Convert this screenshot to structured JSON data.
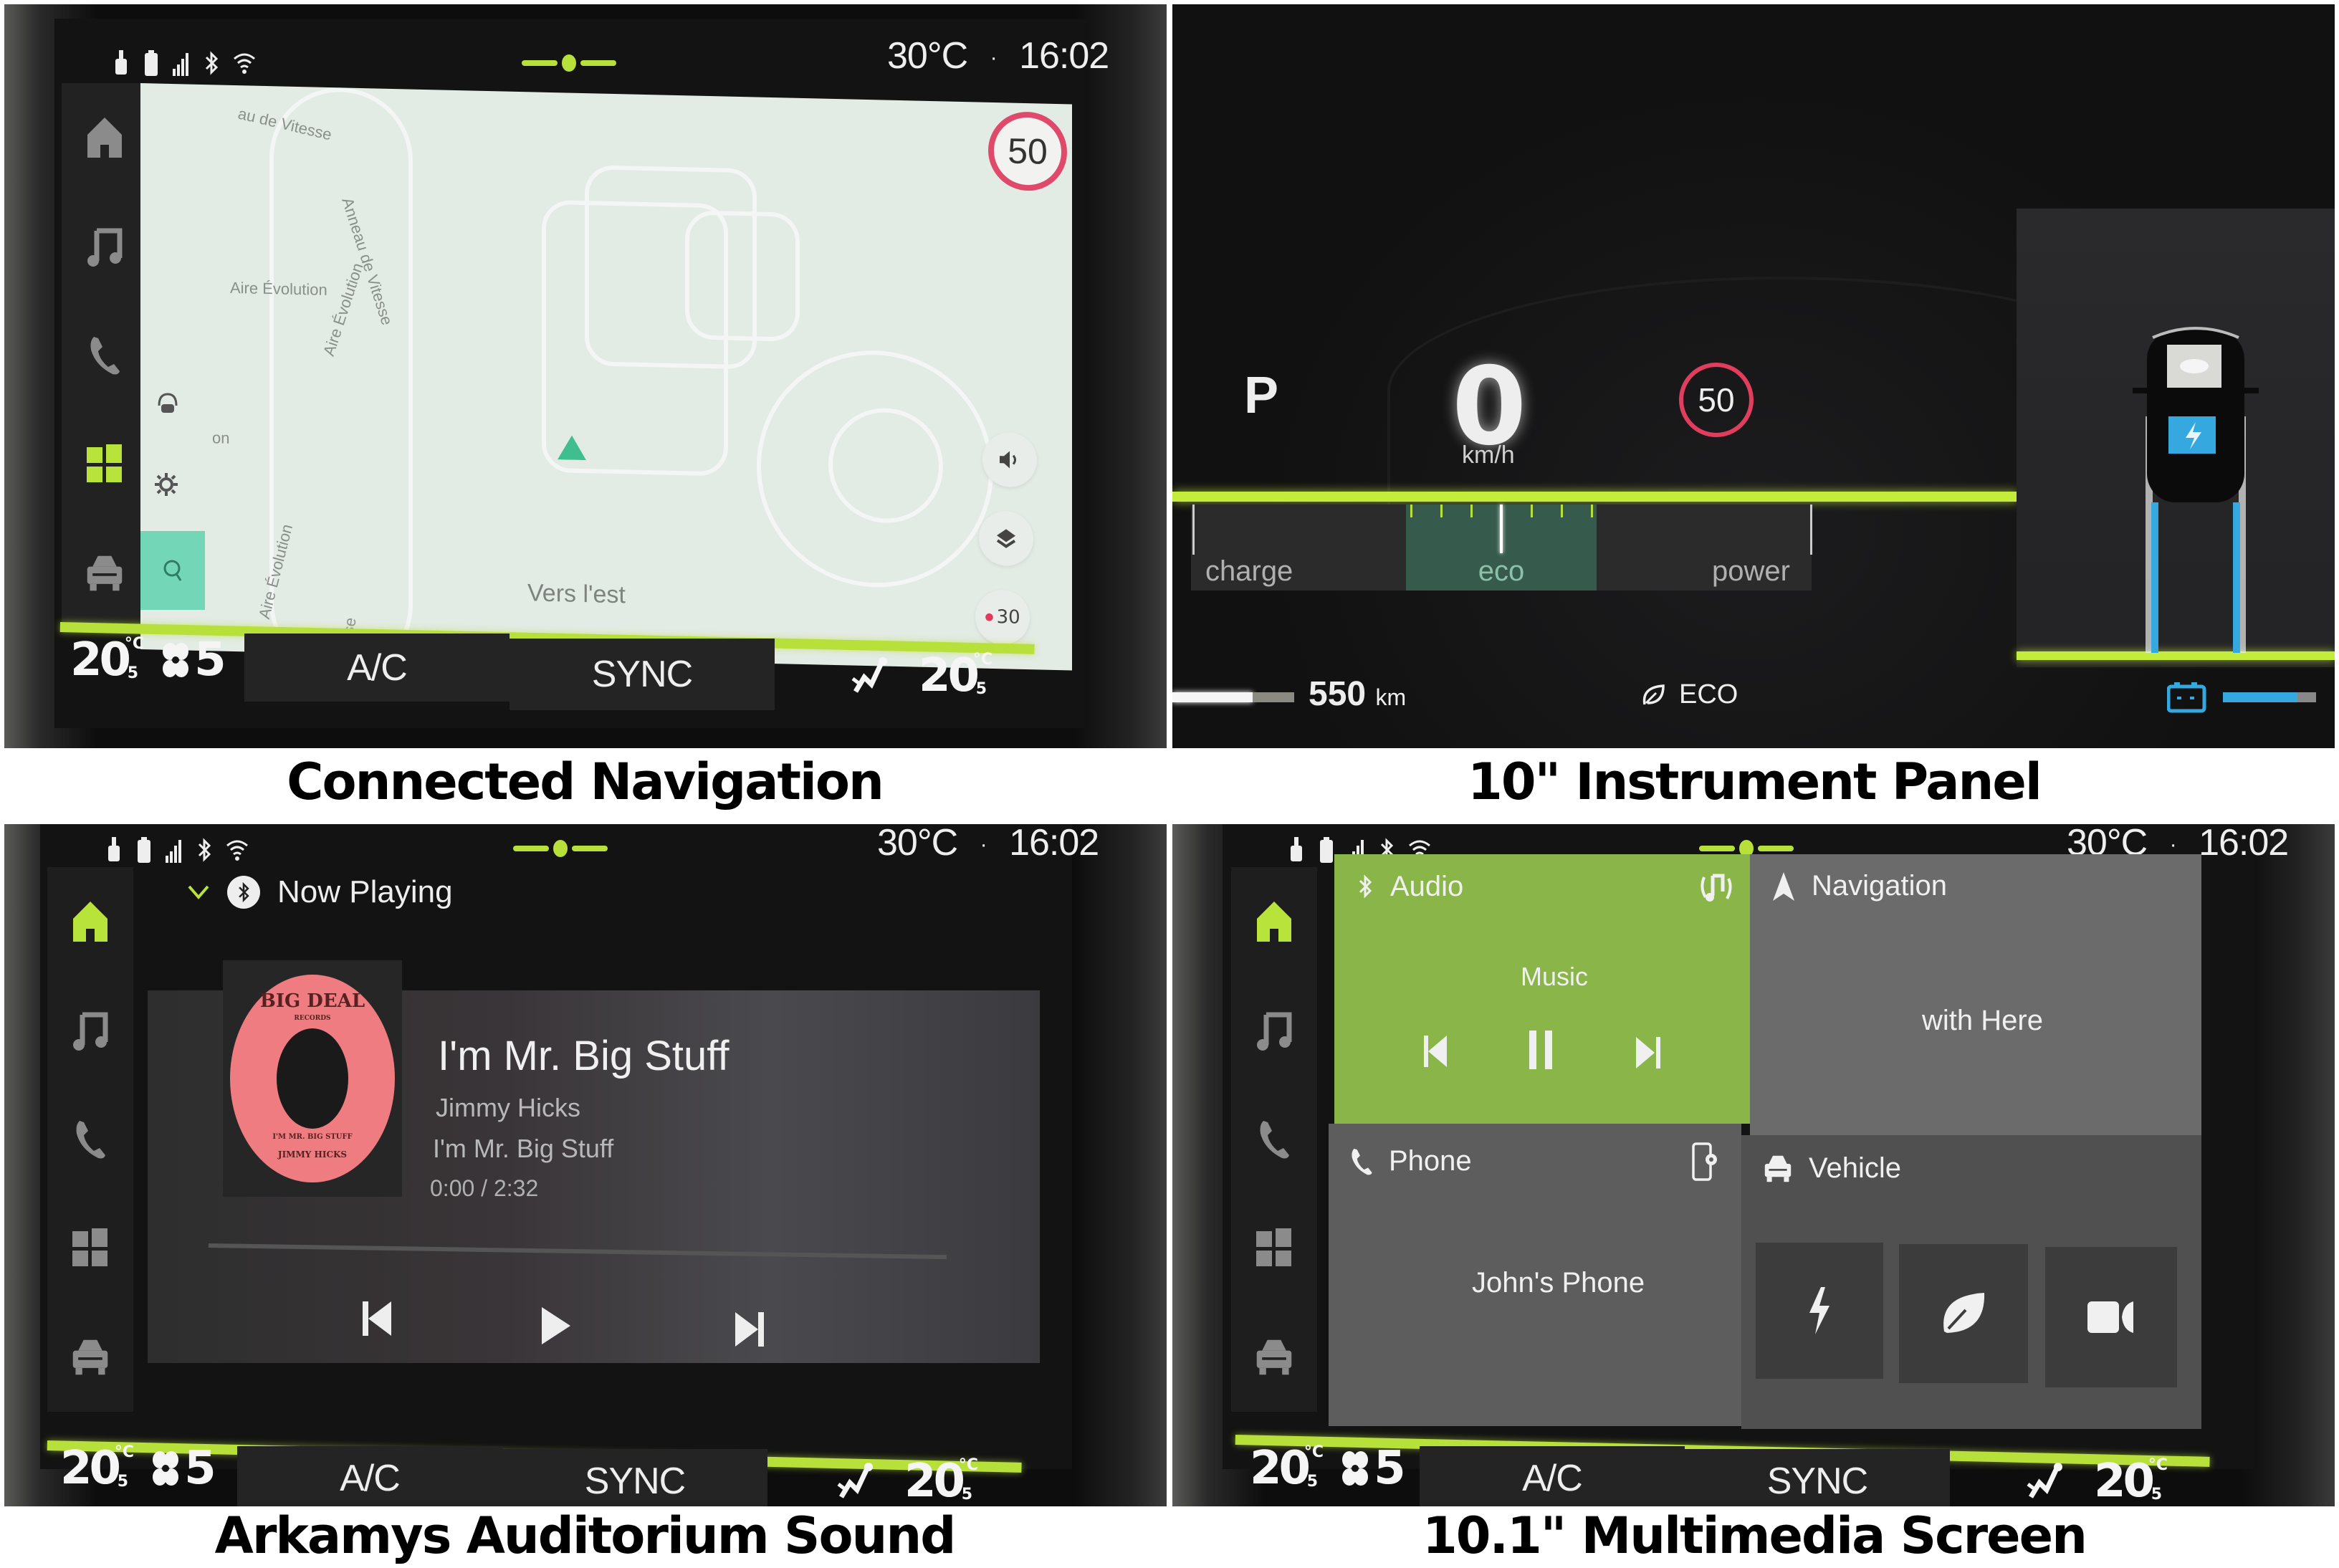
{
  "captions": {
    "nav": "Connected Navigation",
    "instrument": "10\" Instrument Panel",
    "audio": "Arkamys Auditorium Sound",
    "multimedia": "10.1\" Multimedia Screen"
  },
  "statusbar": {
    "outside_temp": "30°C",
    "separator": "·",
    "time": "16:02",
    "icons": [
      "usb-icon",
      "battery-icon",
      "signal-icon",
      "bluetooth-icon",
      "wifi-icon"
    ]
  },
  "leftnav": {
    "items": [
      {
        "name": "home",
        "icon": "home-icon"
      },
      {
        "name": "music",
        "icon": "music-icon"
      },
      {
        "name": "phone",
        "icon": "phone-icon"
      },
      {
        "name": "apps",
        "icon": "apps-grid-icon"
      },
      {
        "name": "vehicle",
        "icon": "car-icon"
      }
    ],
    "active_nav_screen": "apps",
    "active_other_screens": "home"
  },
  "climate": {
    "driver_temp_int": "20",
    "driver_temp_dec": "5",
    "temp_unit": "°C",
    "fan_level": "5",
    "ac_label": "A/C",
    "sync_label": "SYNC",
    "passenger_temp_int": "20",
    "passenger_temp_dec": "5"
  },
  "navigation": {
    "speed_limit": "50",
    "heading_label": "Vers l'est",
    "streets": [
      "au de Vitesse",
      "Anneau de Vitesse",
      "Aire Évolution",
      "Aire Évolution",
      "Aire Évolution",
      "eau de Vitesse"
    ],
    "poi_fragment": "on",
    "zoom_button": "30",
    "accent": "#3fbf8f",
    "search_color": "#73d6b7"
  },
  "instrument": {
    "gear": "P",
    "speed": "0",
    "speed_unit": "km/h",
    "speed_limit": "50",
    "zones": [
      "charge",
      "eco",
      "power"
    ],
    "active_zone": "eco",
    "range_value": "550",
    "range_unit": "km",
    "range_level": 0.66,
    "drive_mode": "ECO",
    "battery_level": 0.8,
    "accent": "#c4ec3a",
    "battery_color": "#36a8e0"
  },
  "now_playing": {
    "header": "Now Playing",
    "source_icon": "bluetooth-icon",
    "track_title": "I'm Mr. Big Stuff",
    "artist": "Jimmy Hicks",
    "album": "I'm Mr. Big Stuff",
    "elapsed": "0:00",
    "duration": "2:32",
    "time_display": "0:00 / 2:32",
    "progress": 0.0,
    "album_art": {
      "label_top": "BIG DEAL",
      "label_sub": "RECORDS",
      "label_song": "I'M MR. BIG STUFF",
      "label_artist": "JIMMY HICKS"
    }
  },
  "home": {
    "audio": {
      "title": "Audio",
      "center": "Music",
      "state": "playing",
      "color": "#8ab548"
    },
    "navigation": {
      "title": "Navigation",
      "center": "with Here"
    },
    "phone": {
      "title": "Phone",
      "center": "John's Phone"
    },
    "vehicle": {
      "title": "Vehicle",
      "shortcuts": [
        "charge-bolt-icon",
        "eco-leaf-icon",
        "camera-icon"
      ]
    }
  }
}
